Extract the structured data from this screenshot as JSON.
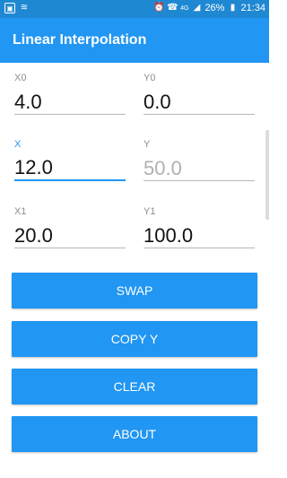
{
  "status_bar": {
    "left_icons": [
      "image-icon",
      "wifi-icon"
    ],
    "right_icons": [
      "alarm-icon",
      "phone-icon",
      "signal-icon"
    ],
    "network": "4G",
    "battery": "26%",
    "time": "21:34"
  },
  "app": {
    "title": "Linear Interpolation"
  },
  "fields": {
    "x0": {
      "label": "X0",
      "value": "4.0"
    },
    "y0": {
      "label": "Y0",
      "value": "0.0"
    },
    "x": {
      "label": "X",
      "value": "12.0"
    },
    "y": {
      "label": "Y",
      "value": "50.0"
    },
    "x1": {
      "label": "X1",
      "value": "20.0"
    },
    "y1": {
      "label": "Y1",
      "value": "100.0"
    }
  },
  "buttons": {
    "swap": "SWAP",
    "copy_y": "COPY Y",
    "clear": "CLEAR",
    "about": "ABOUT"
  },
  "colors": {
    "status_bar": "#1f88d2",
    "app_bar": "#2196f3",
    "accent": "#2196f3"
  }
}
